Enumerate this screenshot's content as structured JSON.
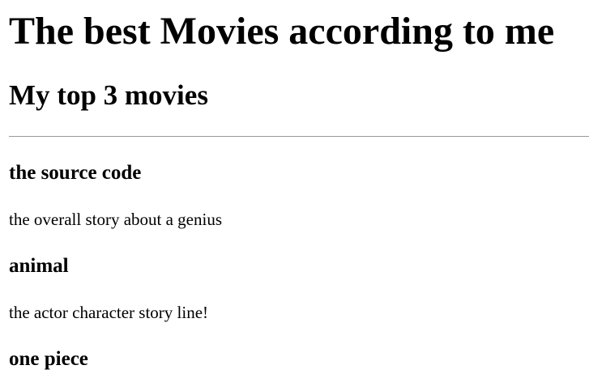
{
  "page": {
    "title": "The best Movies according to me",
    "subtitle": "My top 3 movies"
  },
  "movies": [
    {
      "title": "the source code",
      "description": "the overall story about a genius"
    },
    {
      "title": "animal",
      "description": "the actor character story line!"
    },
    {
      "title": "one piece"
    }
  ],
  "colors": {
    "text": "#000000",
    "background": "#ffffff",
    "divider": "#9a9a9a"
  }
}
